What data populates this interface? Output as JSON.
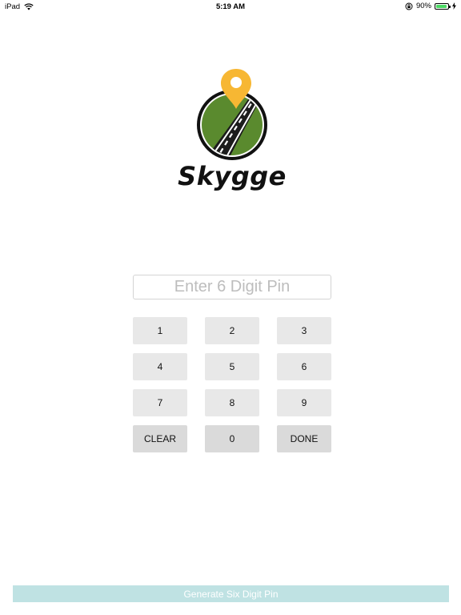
{
  "status_bar": {
    "device": "iPad",
    "time": "5:19 AM",
    "battery": "90%",
    "battery_level": 0.9,
    "icons": [
      "wifi-icon",
      "orientation-lock-icon",
      "battery-icon",
      "charging-icon"
    ]
  },
  "logo": {
    "brand": "Skygge",
    "icon": "map-pin-road-icon",
    "colors": {
      "pin": "#f7b733",
      "globe": "#5a8a2e",
      "ring": "#111111",
      "road": "#1c1c1c"
    }
  },
  "pin_input": {
    "placeholder": "Enter 6 Digit Pin",
    "value": ""
  },
  "keypad": {
    "keys": [
      "1",
      "2",
      "3",
      "4",
      "5",
      "6",
      "7",
      "8",
      "9",
      "CLEAR",
      "0",
      "DONE"
    ]
  },
  "generate_button": {
    "label": "Generate Six Digit Pin",
    "color": "#bfe2e3"
  }
}
